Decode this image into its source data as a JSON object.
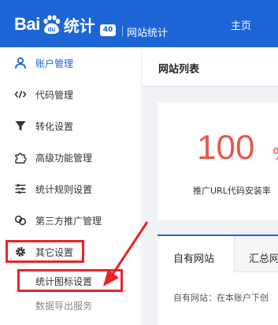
{
  "header": {
    "logo_left": "Bai",
    "logo_right": "统计",
    "version_badge": "40",
    "site_stats": "网站统计",
    "home": "主页"
  },
  "sidebar": {
    "items": [
      {
        "label": "账户管理",
        "icon": "user-icon"
      },
      {
        "label": "代码管理",
        "icon": "code-icon"
      },
      {
        "label": "转化设置",
        "icon": "filter-icon"
      },
      {
        "label": "高级功能管理",
        "icon": "puzzle-icon"
      },
      {
        "label": "统计规则设置",
        "icon": "sliders-icon"
      },
      {
        "label": "第三方推广管理",
        "icon": "link-icon"
      },
      {
        "label": "其它设置",
        "icon": "gear-icon"
      }
    ],
    "sub_items": [
      {
        "label": "统计图标设置"
      },
      {
        "label": "数据导出服务"
      }
    ]
  },
  "main": {
    "title": "网站列表",
    "stat": {
      "value": "100",
      "unit": "%",
      "label": "推广URL代码安装率"
    },
    "tabs": [
      {
        "label": "自有网站"
      },
      {
        "label": "汇总网"
      }
    ],
    "tab_description": "自有网站：在本账户下创"
  },
  "colors": {
    "brand": "#1d64d6",
    "stat_red": "#e35a4b",
    "annotation_red": "#e8242a"
  }
}
